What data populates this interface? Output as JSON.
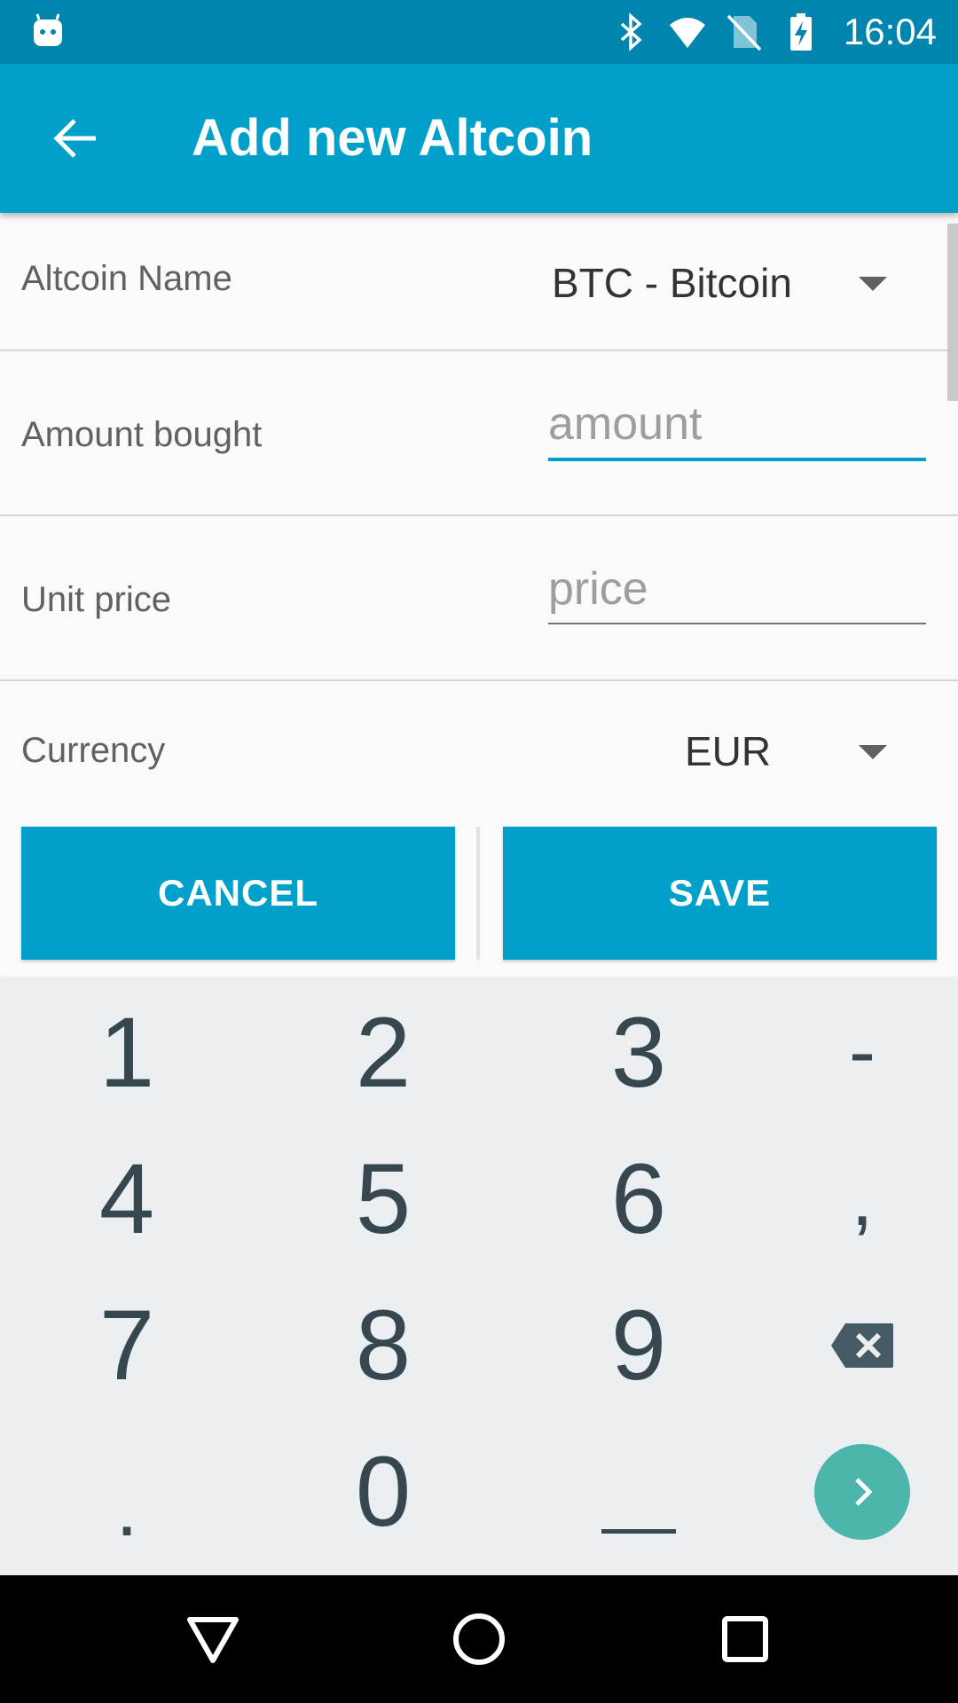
{
  "status_bar": {
    "time": "16:04",
    "icons": [
      "android-notification-icon",
      "bluetooth-icon",
      "wifi-icon",
      "no-sim-icon",
      "battery-charging-icon"
    ]
  },
  "app_bar": {
    "title": "Add new Altcoin",
    "back_icon": "arrow-back-icon"
  },
  "form": {
    "altcoin_name": {
      "label": "Altcoin Name",
      "value": "BTC - Bitcoin"
    },
    "amount": {
      "label": "Amount bought",
      "value": "",
      "placeholder": "amount"
    },
    "unit_price": {
      "label": "Unit price",
      "value": "",
      "placeholder": "price"
    },
    "currency": {
      "label": "Currency",
      "value": "EUR"
    }
  },
  "actions": {
    "cancel_label": "CANCEL",
    "save_label": "SAVE"
  },
  "keyboard": {
    "rows": [
      [
        "1",
        "2",
        "3",
        "-"
      ],
      [
        "4",
        "5",
        "6",
        ","
      ],
      [
        "7",
        "8",
        "9",
        "backspace"
      ],
      [
        ".",
        "0",
        "space",
        "go"
      ]
    ],
    "accent_color": "#4DB6AC"
  },
  "colors": {
    "status_bar": "#0085AE",
    "primary": "#00A0CB",
    "key_text": "#37474F"
  },
  "nav_bar": {
    "buttons": [
      "back-triangle-icon",
      "home-circle-icon",
      "recents-square-icon"
    ]
  }
}
